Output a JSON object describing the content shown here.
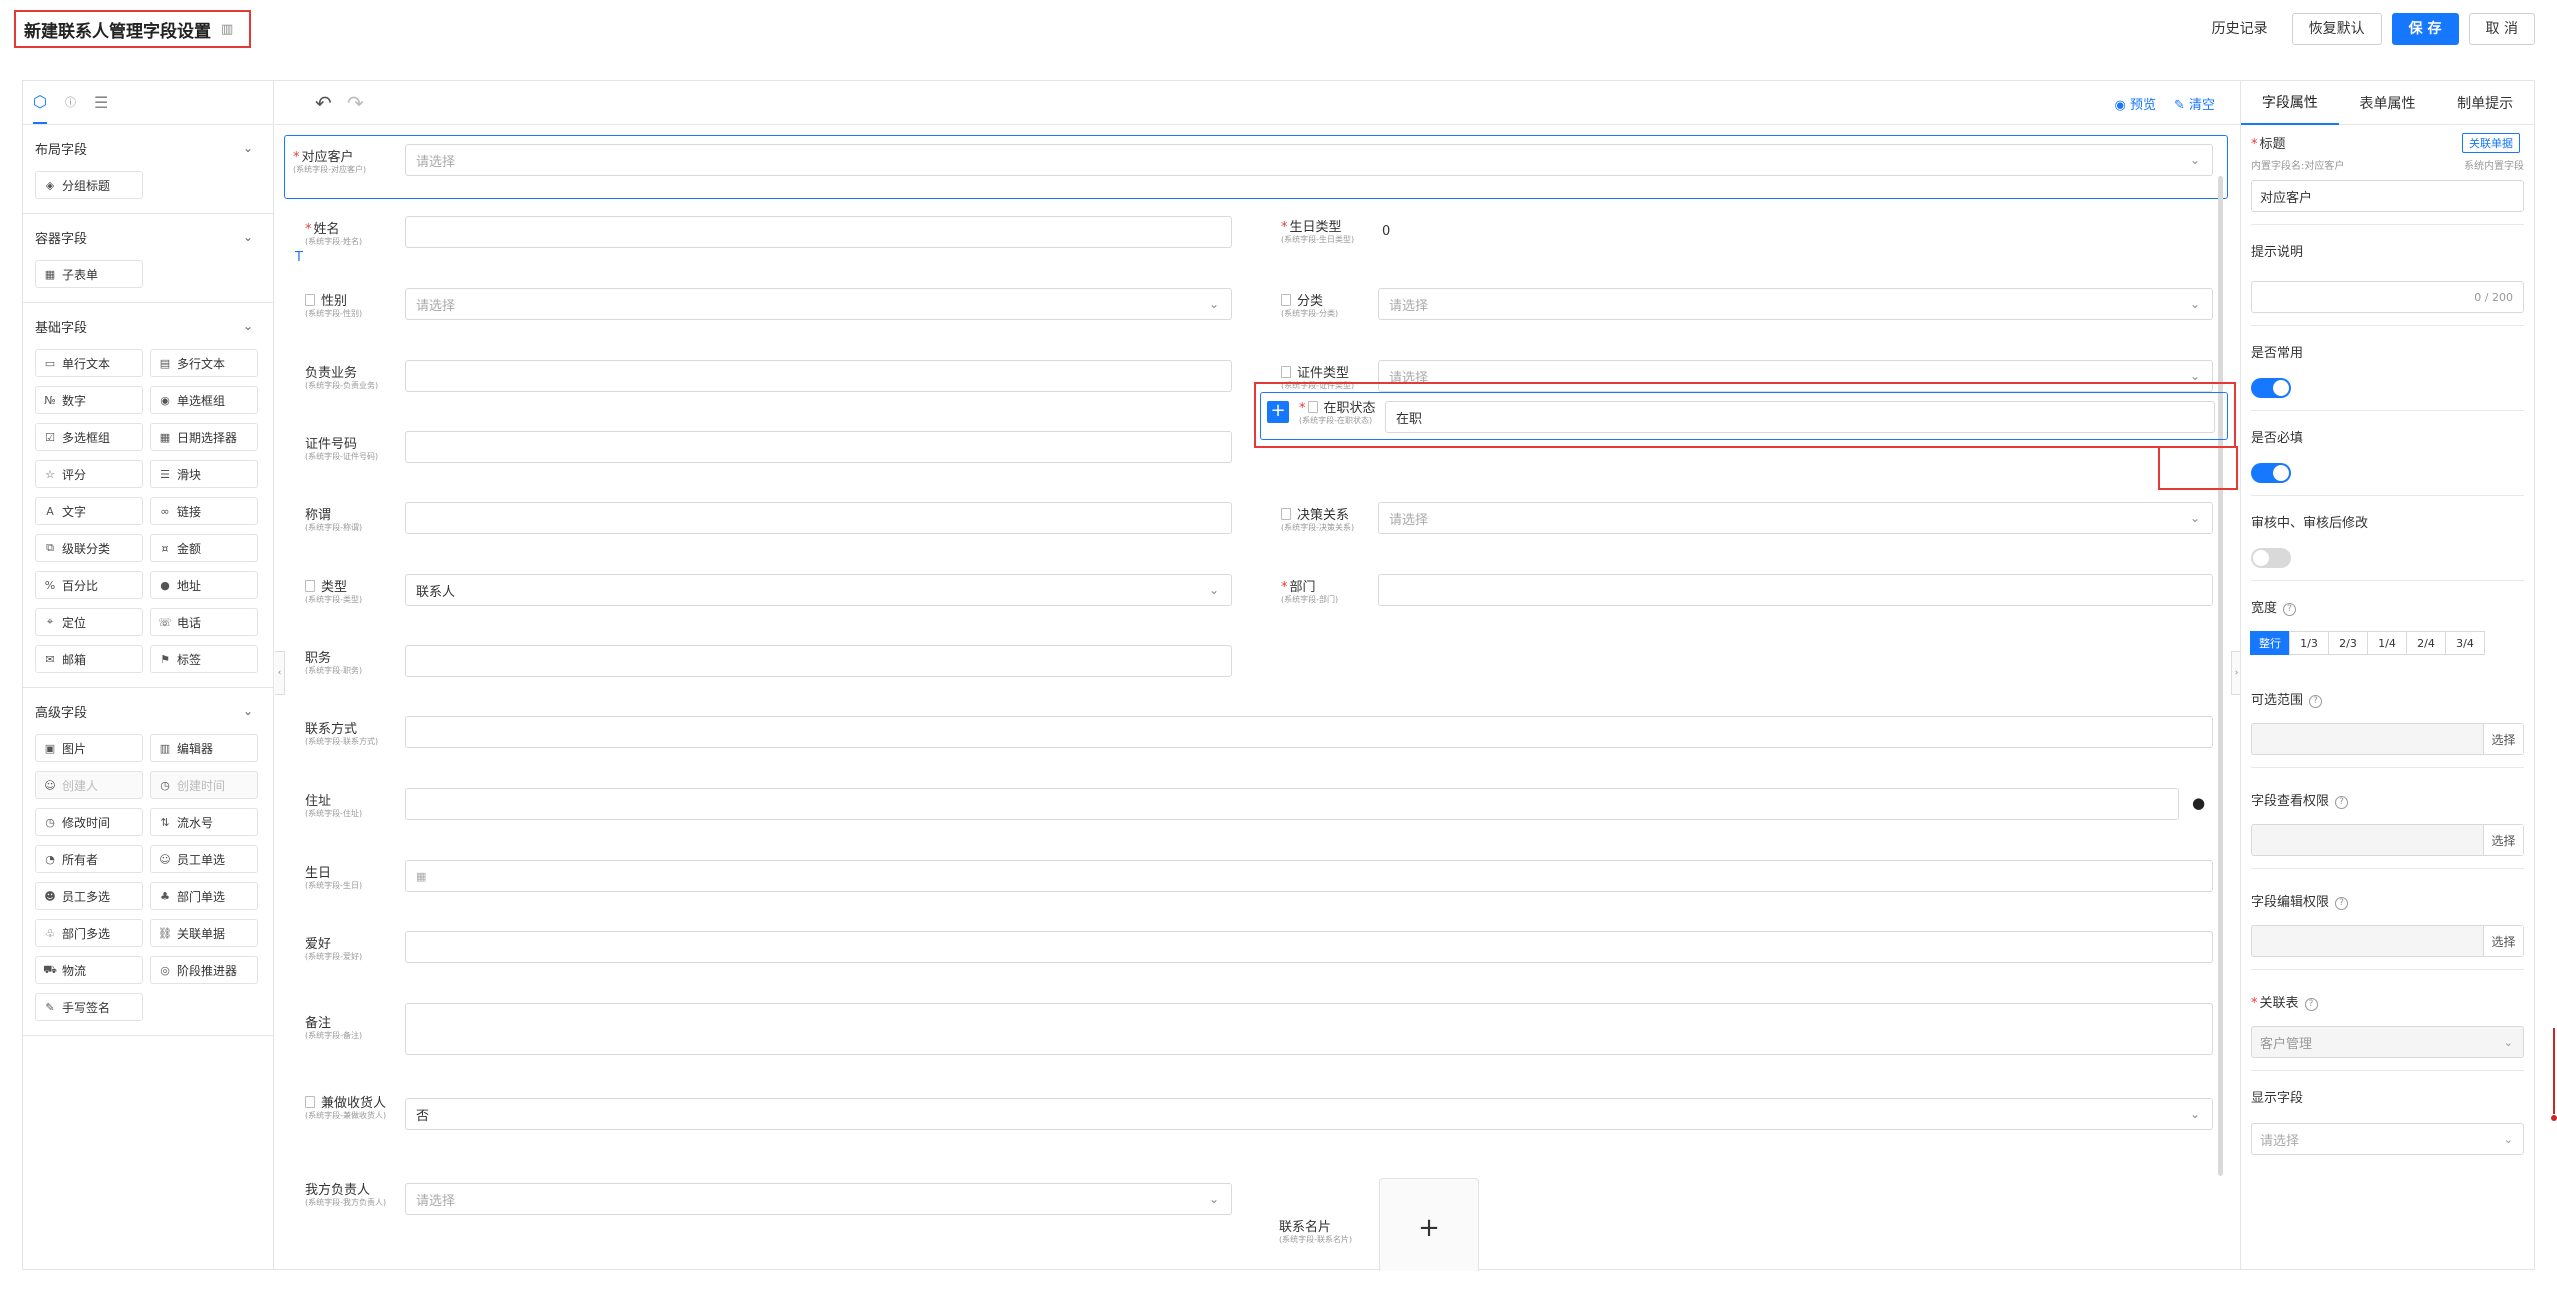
{
  "header": {
    "title": "新建联系人管理字段设置",
    "history": "历史记录",
    "restore": "恢复默认",
    "save": "保 存",
    "cancel": "取 消"
  },
  "left_panel": {
    "groups": [
      {
        "title": "布局字段",
        "items": [
          {
            "label": "分组标题",
            "icon": "group-title-icon"
          }
        ]
      },
      {
        "title": "容器字段",
        "items": [
          {
            "label": "子表单",
            "icon": "table-icon"
          }
        ]
      },
      {
        "title": "基础字段",
        "items": [
          {
            "label": "单行文本",
            "icon": "single-line-icon"
          },
          {
            "label": "多行文本",
            "icon": "multi-line-icon"
          },
          {
            "label": "数字",
            "icon": "number-icon"
          },
          {
            "label": "单选框组",
            "icon": "radio-icon"
          },
          {
            "label": "多选框组",
            "icon": "checkbox-icon"
          },
          {
            "label": "日期选择器",
            "icon": "calendar-icon"
          },
          {
            "label": "评分",
            "icon": "star-icon"
          },
          {
            "label": "滑块",
            "icon": "slider-icon"
          },
          {
            "label": "文字",
            "icon": "text-icon"
          },
          {
            "label": "链接",
            "icon": "link-icon"
          },
          {
            "label": "级联分类",
            "icon": "cascade-icon"
          },
          {
            "label": "金额",
            "icon": "money-icon"
          },
          {
            "label": "百分比",
            "icon": "percent-icon"
          },
          {
            "label": "地址",
            "icon": "location-pin-icon"
          },
          {
            "label": "定位",
            "icon": "position-icon"
          },
          {
            "label": "电话",
            "icon": "phone-icon"
          },
          {
            "label": "邮箱",
            "icon": "mail-icon"
          },
          {
            "label": "标签",
            "icon": "tag-icon"
          }
        ]
      },
      {
        "title": "高级字段",
        "items": [
          {
            "label": "图片",
            "icon": "image-icon"
          },
          {
            "label": "编辑器",
            "icon": "editor-icon"
          },
          {
            "label": "创建人",
            "icon": "user-icon",
            "disabled": true
          },
          {
            "label": "创建时间",
            "icon": "clock-icon",
            "disabled": true
          },
          {
            "label": "修改时间",
            "icon": "clock-icon"
          },
          {
            "label": "流水号",
            "icon": "serial-icon"
          },
          {
            "label": "所有者",
            "icon": "owner-icon"
          },
          {
            "label": "员工单选",
            "icon": "user-icon"
          },
          {
            "label": "员工多选",
            "icon": "users-icon"
          },
          {
            "label": "部门单选",
            "icon": "department-icon"
          },
          {
            "label": "部门多选",
            "icon": "departments-icon"
          },
          {
            "label": "关联单据",
            "icon": "link-doc-icon"
          },
          {
            "label": "物流",
            "icon": "logistics-icon"
          },
          {
            "label": "阶段推进器",
            "icon": "stage-icon"
          },
          {
            "label": "手写签名",
            "icon": "signature-icon"
          }
        ]
      }
    ]
  },
  "toolbar": {
    "preview": "预览",
    "clear": "清空"
  },
  "form": {
    "placeholder": "请选择",
    "customer": {
      "label": "对应客户",
      "sub": "(系统字段-对应客户)"
    },
    "name": {
      "label": "姓名",
      "sub": "(系统字段-姓名)"
    },
    "birthday_type": {
      "label": "生日类型",
      "sub": "(系统字段-生日类型)",
      "value": "0"
    },
    "gender": {
      "label": "性别",
      "sub": "(系统字段-性别)"
    },
    "category": {
      "label": "分类",
      "sub": "(系统字段-分类)"
    },
    "business": {
      "label": "负责业务",
      "sub": "(系统字段-负责业务)"
    },
    "id_type": {
      "label": "证件类型",
      "sub": "(系统字段-证件类型)"
    },
    "id_number": {
      "label": "证件号码",
      "sub": "(系统字段-证件号码)"
    },
    "job_status": {
      "label": "在职状态",
      "sub": "(系统字段-在职状态)",
      "value": "在职"
    },
    "title": {
      "label": "称谓",
      "sub": "(系统字段-称谓)"
    },
    "decision": {
      "label": "决策关系",
      "sub": "(系统字段-决策关系)"
    },
    "type": {
      "label": "类型",
      "sub": "(系统字段-类型)",
      "value": "联系人"
    },
    "department": {
      "label": "部门",
      "sub": "(系统字段-部门)"
    },
    "position": {
      "label": "职务",
      "sub": "(系统字段-职务)"
    },
    "contact": {
      "label": "联系方式",
      "sub": "(系统字段-联系方式)"
    },
    "address": {
      "label": "住址",
      "sub": "(系统字段-住址)"
    },
    "birthday": {
      "label": "生日",
      "sub": "(系统字段-生日)"
    },
    "hobby": {
      "label": "爱好",
      "sub": "(系统字段-爱好)"
    },
    "remark": {
      "label": "备注",
      "sub": "(系统字段-备注)"
    },
    "receiver": {
      "label": "兼做收货人",
      "sub": "(系统字段-兼做收货人)",
      "value": "否"
    },
    "owner": {
      "label": "我方负责人",
      "sub": "(系统字段-我方负责人)"
    },
    "card": {
      "label": "联系名片",
      "sub": "(系统字段-联系名片)"
    }
  },
  "right_panel": {
    "tabs": [
      "字段属性",
      "表单属性",
      "制单提示"
    ],
    "title_label": "标题",
    "link_doc": "关联单据",
    "title_sub_left": "内置字段名:对应客户",
    "title_sub_right": "系统内置字段",
    "title_value": "对应客户",
    "hint_label": "提示说明",
    "hint_count": "0 / 200",
    "common_label": "是否常用",
    "required_label": "是否必填",
    "audit_label": "审核中、审核后修改",
    "width_label": "宽度",
    "width_options": [
      "整行",
      "1/3",
      "2/3",
      "1/4",
      "2/4",
      "3/4"
    ],
    "range_label": "可选范围",
    "pick": "选择",
    "view_perm_label": "字段查看权限",
    "edit_perm_label": "字段编辑权限",
    "link_table_label": "关联表",
    "link_table_value": "客户管理",
    "display_label": "显示字段",
    "display_placeholder": "请选择",
    "states": {
      "common": true,
      "required": true,
      "audit": false
    }
  }
}
